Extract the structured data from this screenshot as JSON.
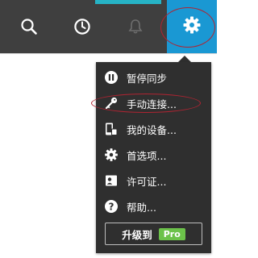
{
  "toolbar": {
    "buttons": [
      {
        "name": "search",
        "icon": "search-icon"
      },
      {
        "name": "history",
        "icon": "clock-icon"
      },
      {
        "name": "notifications",
        "icon": "bell-icon"
      },
      {
        "name": "settings",
        "icon": "gear-icon",
        "active": true
      }
    ],
    "colors": {
      "bar": "#3f3f3f",
      "active": "#1a98d3",
      "accent": "#26b3c5"
    }
  },
  "menu": {
    "items": [
      {
        "label": "暂停同步",
        "icon": "pause-icon"
      },
      {
        "label": "手动连接...",
        "icon": "key-icon"
      },
      {
        "label": "我的设备...",
        "icon": "devices-icon"
      },
      {
        "label": "首选项...",
        "icon": "gear-icon"
      },
      {
        "label": "许可证...",
        "icon": "license-icon"
      },
      {
        "label": "帮助...",
        "icon": "help-icon"
      }
    ],
    "upgrade": {
      "label": "升级到",
      "badge": "Pro"
    },
    "colors": {
      "background": "#2f2f2f",
      "badge": "#6cc24a",
      "highlight": "#b02432"
    }
  }
}
